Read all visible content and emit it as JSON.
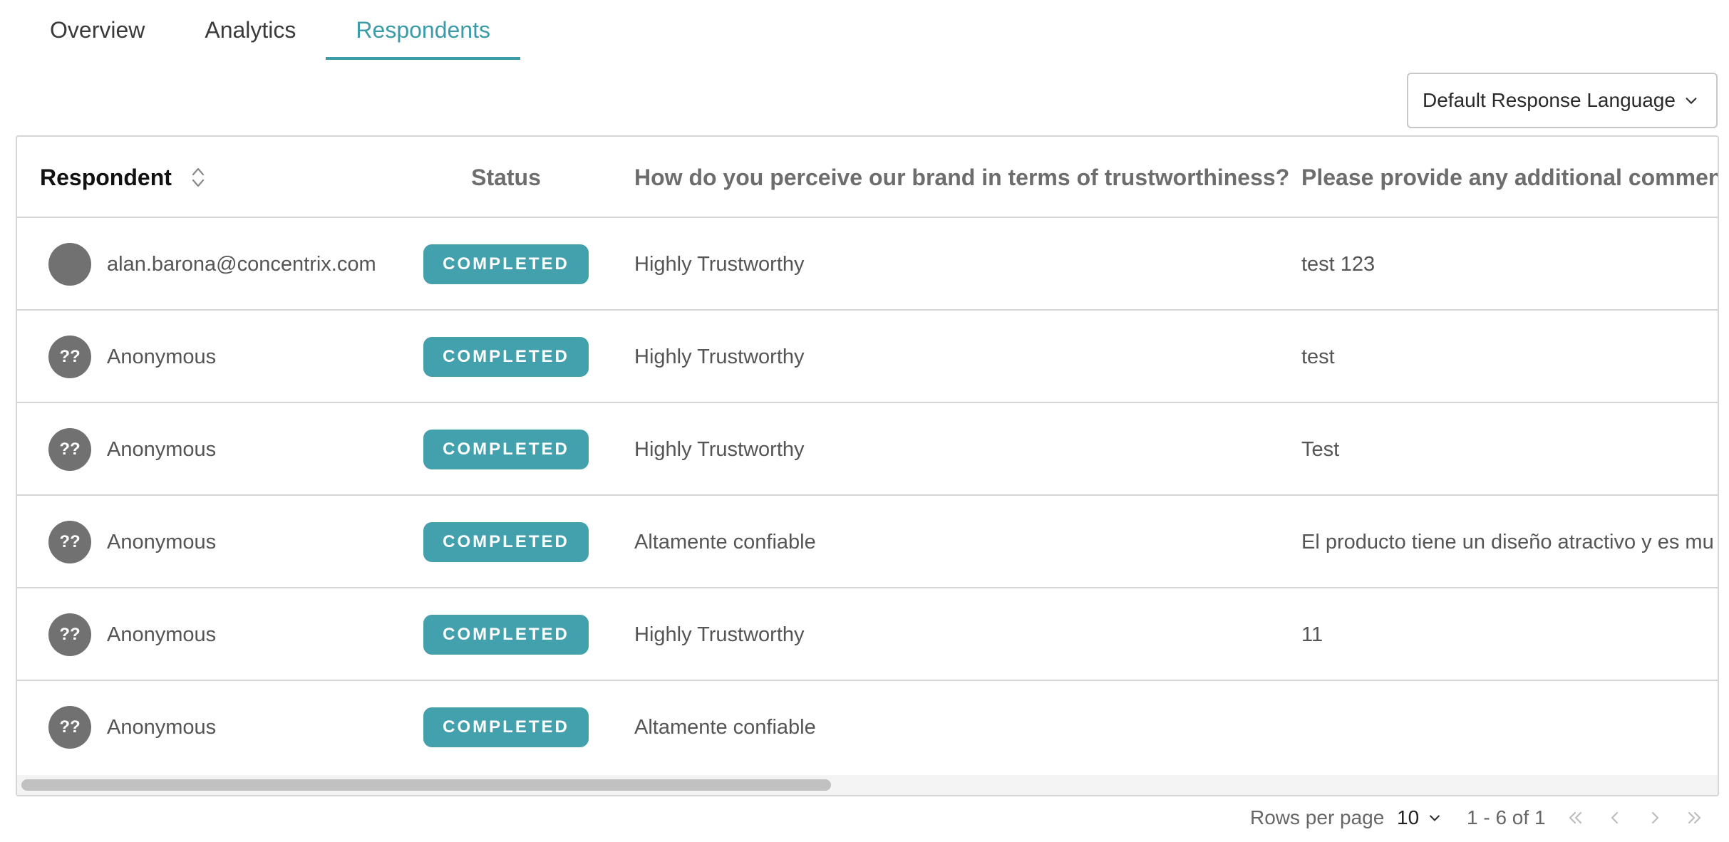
{
  "tabs": [
    {
      "label": "Overview",
      "active": false
    },
    {
      "label": "Analytics",
      "active": false
    },
    {
      "label": "Respondents",
      "active": true
    }
  ],
  "language_select": {
    "value": "Default Response Language"
  },
  "table": {
    "columns": [
      "Respondent",
      "Status",
      "How do you perceive our brand in terms of trustworthiness?",
      "Please provide any additional comments"
    ],
    "rows": [
      {
        "avatar": "",
        "respondent": "alan.barona@concentrix.com",
        "status": "COMPLETED",
        "q1": "Highly Trustworthy",
        "q2": "test 123"
      },
      {
        "avatar": "??",
        "respondent": "Anonymous",
        "status": "COMPLETED",
        "q1": "Highly Trustworthy",
        "q2": "test"
      },
      {
        "avatar": "??",
        "respondent": "Anonymous",
        "status": "COMPLETED",
        "q1": "Highly Trustworthy",
        "q2": "Test"
      },
      {
        "avatar": "??",
        "respondent": "Anonymous",
        "status": "COMPLETED",
        "q1": "Altamente confiable",
        "q2": "El producto tiene un diseño atractivo y es mu"
      },
      {
        "avatar": "??",
        "respondent": "Anonymous",
        "status": "COMPLETED",
        "q1": "Highly Trustworthy",
        "q2": "11"
      },
      {
        "avatar": "??",
        "respondent": "Anonymous",
        "status": "COMPLETED",
        "q1": "Altamente confiable",
        "q2": ""
      }
    ]
  },
  "pagination": {
    "rows_per_page_label": "Rows per page",
    "rows_per_page_value": "10",
    "range_text": "1 - 6 of 1"
  },
  "colors": {
    "accent": "#3b9ba8",
    "badge": "#43a0ad",
    "avatar": "#717171"
  },
  "icons": [
    "sort-icon",
    "chevron-down-icon",
    "first-page-icon",
    "prev-page-icon",
    "next-page-icon",
    "last-page-icon"
  ]
}
